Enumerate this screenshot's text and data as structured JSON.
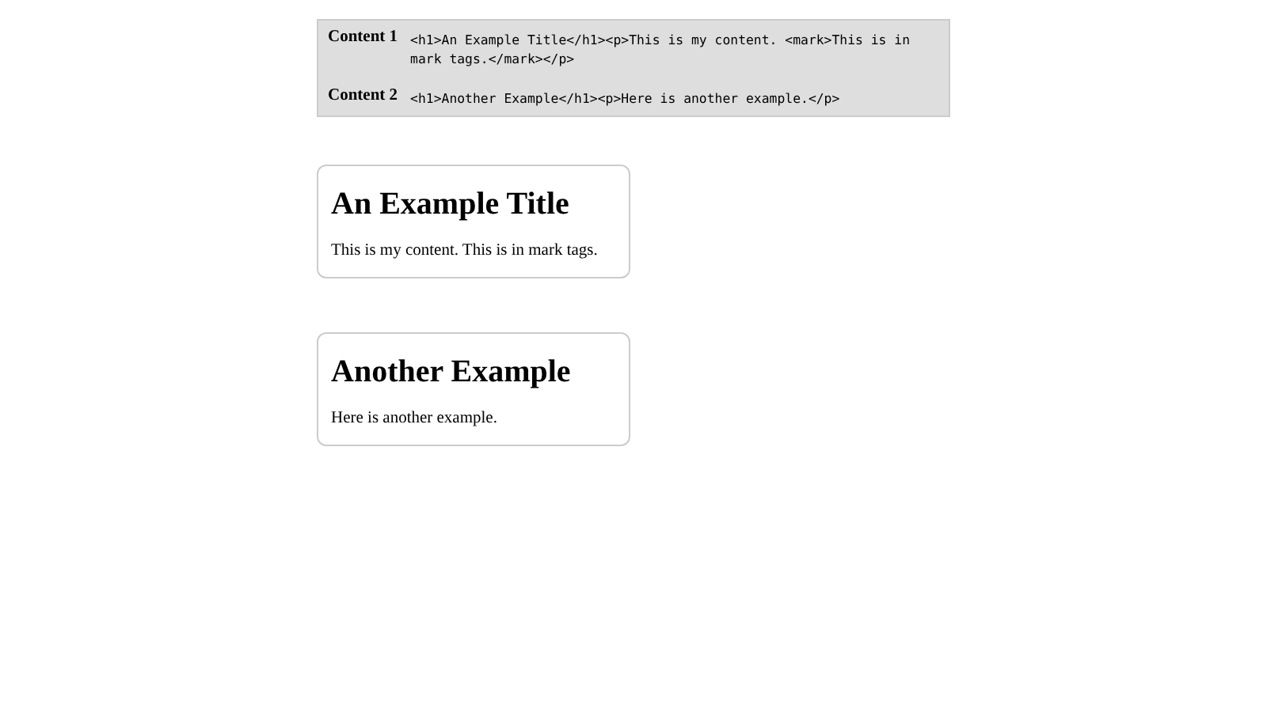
{
  "sources": [
    {
      "label": "Content 1",
      "code": "<h1>An Example Title</h1><p>This is my content. <mark>This is in mark tags.</mark></p>"
    },
    {
      "label": "Content 2",
      "code": "<h1>Another Example</h1><p>Here is another example.</p>"
    }
  ],
  "cards": [
    {
      "title": "An Example Title",
      "text": "This is my content. This is in mark tags."
    },
    {
      "title": "Another Example",
      "text": "Here is another example."
    }
  ]
}
